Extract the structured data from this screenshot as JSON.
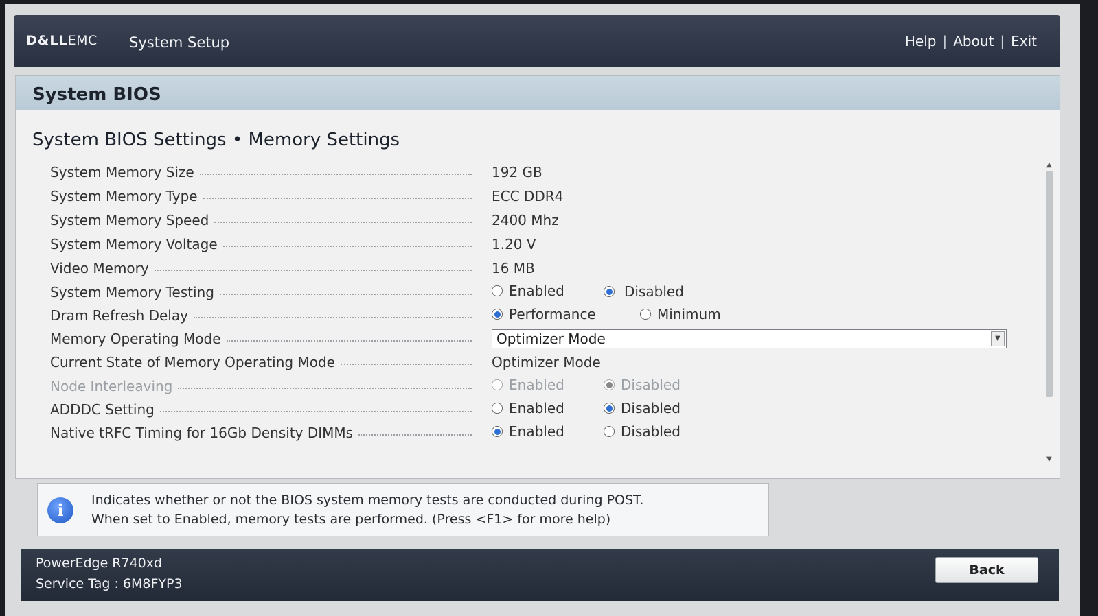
{
  "header": {
    "brand_primary": "D&LL",
    "brand_secondary": "EMC",
    "app_title": "System Setup",
    "links": {
      "help": "Help",
      "about": "About",
      "exit": "Exit",
      "separator": "|"
    }
  },
  "panel": {
    "title": "System BIOS",
    "section_title": "System BIOS Settings • Memory Settings"
  },
  "settings": {
    "memory_size": {
      "label": "System Memory Size",
      "value": "192 GB"
    },
    "memory_type": {
      "label": "System Memory Type",
      "value": "ECC DDR4"
    },
    "memory_speed": {
      "label": "System Memory Speed",
      "value": "2400 Mhz"
    },
    "memory_voltage": {
      "label": "System Memory Voltage",
      "value": "1.20 V"
    },
    "video_memory": {
      "label": "Video Memory",
      "value": "16 MB"
    },
    "memory_testing": {
      "label": "System Memory Testing",
      "options": [
        "Enabled",
        "Disabled"
      ],
      "selected": "Disabled"
    },
    "dram_refresh_delay": {
      "label": "Dram Refresh Delay",
      "options": [
        "Performance",
        "Minimum"
      ],
      "selected": "Performance"
    },
    "memory_operating_mode": {
      "label": "Memory Operating Mode",
      "value": "Optimizer Mode"
    },
    "current_state_mode": {
      "label": "Current State of Memory Operating Mode",
      "value": "Optimizer Mode"
    },
    "node_interleaving": {
      "label": "Node Interleaving",
      "options": [
        "Enabled",
        "Disabled"
      ],
      "selected": "Disabled",
      "disabled": true
    },
    "adddc_setting": {
      "label": "ADDDC Setting",
      "options": [
        "Enabled",
        "Disabled"
      ],
      "selected": "Disabled"
    },
    "native_trfc": {
      "label": "Native tRFC Timing for 16Gb Density DIMMs",
      "options": [
        "Enabled",
        "Disabled"
      ],
      "selected": "Enabled"
    }
  },
  "info": {
    "icon": "info-icon",
    "line1": "Indicates whether or not the BIOS system memory tests are conducted during POST.",
    "line2": "When set to Enabled, memory tests are performed. (Press <F1> for more help)"
  },
  "footer": {
    "model": "PowerEdge R740xd",
    "service_tag": "Service Tag : 6M8FYP3",
    "back_label": "Back"
  },
  "colors": {
    "header_bg": "#2f3748",
    "panel_head_bg": "#c2d2de",
    "radio_selected": "#2f6fd2",
    "footer_bg": "#2b3240"
  }
}
